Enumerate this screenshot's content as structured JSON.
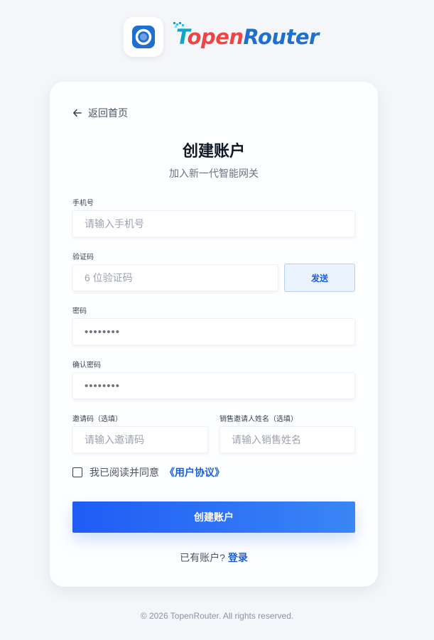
{
  "brand": {
    "wordmark_parts": [
      "T",
      "open",
      "R",
      "outer"
    ],
    "colors": {
      "icon": "#1f6fd0",
      "accent_red": "#ef4444",
      "accent_teal": "#0ea5c6"
    }
  },
  "nav": {
    "back_label": "返回首页",
    "back_icon": "arrow-left-icon"
  },
  "header": {
    "title": "创建账户",
    "subtitle": "加入新一代智能网关"
  },
  "form": {
    "phone": {
      "label": "手机号",
      "placeholder": "请输入手机号"
    },
    "code": {
      "label": "验证码",
      "placeholder": "6 位验证码",
      "send_label": "发送"
    },
    "password": {
      "label": "密码",
      "value": "••••••••"
    },
    "confirm": {
      "label": "确认密码",
      "value": "••••••••"
    },
    "invite": {
      "label": "邀请码（选填）",
      "placeholder": "请输入邀请码"
    },
    "sales": {
      "label": "销售邀请人姓名（选填）",
      "placeholder": "请输入销售姓名"
    },
    "agree": {
      "text": "我已阅读并同意",
      "link": "《用户协议》",
      "checked": false
    },
    "submit_label": "创建账户"
  },
  "login": {
    "prompt": "已有账户?",
    "link": "登录"
  },
  "footer": {
    "copyright": "© 2026 TopenRouter. All rights reserved."
  },
  "colors": {
    "primary": "#1f5cf5",
    "link": "#1d5fd6",
    "background": "#f4f6f9"
  }
}
